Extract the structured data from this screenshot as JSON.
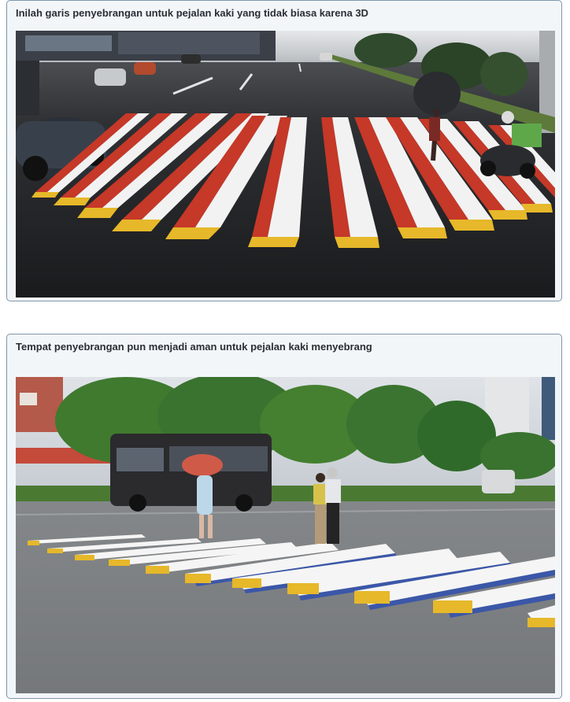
{
  "articles": [
    {
      "caption": "Inilah garis penyebrangan untuk pejalan kaki yang tidak biasa karena 3D",
      "image_icon": "photo-3d-crosswalk-red-yellow-rainy-street"
    },
    {
      "caption": "Tempat penyebrangan pun menjadi aman untuk pejalan kaki menyebrang",
      "image_icon": "photo-3d-crosswalk-blue-yellow-pedestrians-bus"
    }
  ],
  "colors": {
    "card_border": "#7f96ac",
    "card_bg": "#f3f6f9",
    "caption_text": "#2a2f36"
  }
}
